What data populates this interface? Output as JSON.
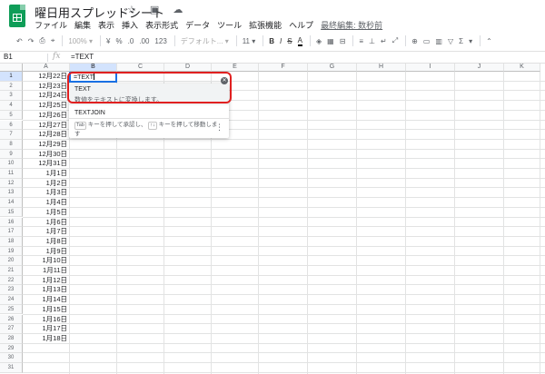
{
  "app": {
    "doc_title": "曜日用スプレッドシート",
    "title_icons": "☆ ▣ ☁"
  },
  "menu": {
    "items": [
      "ファイル",
      "編集",
      "表示",
      "挿入",
      "表示形式",
      "データ",
      "ツール",
      "拡張機能",
      "ヘルプ"
    ],
    "last_edit": "最終編集: 数秒前"
  },
  "toolbar": {
    "undo": "↶",
    "redo": "↷",
    "print": "⎙",
    "paint": "⌖",
    "zoom": "100%",
    "zoom_caret": "▾",
    "currency": "¥",
    "percent": "%",
    "dec_less": ".0",
    "dec_more": ".00",
    "more_formats": "123",
    "font": "デフォルト...",
    "font_caret": "▾",
    "font_size": "11",
    "size_caret": "▾",
    "bold": "B",
    "italic": "I",
    "strike": "S",
    "text_color": "A",
    "fill": "◈",
    "borders": "▦",
    "merge": "⊟",
    "halign": "≡",
    "valign": "⊥",
    "wrap": "↵",
    "rotate": "⤢",
    "link": "⊕",
    "comment": "▭",
    "chart": "▥",
    "filter": "▽",
    "functions": "Σ",
    "more_caret": "▾",
    "collapse": "⌃"
  },
  "formula_bar": {
    "name_box": "B1",
    "fx": "fx",
    "content": "=TEXT"
  },
  "grid": {
    "columns": [
      "A",
      "B",
      "C",
      "D",
      "E",
      "F",
      "G",
      "H",
      "I",
      "J",
      "K"
    ],
    "rows": [
      "1",
      "2",
      "3",
      "4",
      "5",
      "6",
      "7",
      "8",
      "9",
      "10",
      "11",
      "12",
      "13",
      "14",
      "15",
      "16",
      "17",
      "18",
      "19",
      "20",
      "21",
      "22",
      "23",
      "24",
      "25",
      "26",
      "27",
      "28",
      "29",
      "30",
      "31"
    ],
    "column_a_values": [
      "12月22日",
      "12月23日",
      "12月24日",
      "12月25日",
      "12月26日",
      "12月27日",
      "12月28日",
      "12月29日",
      "12月30日",
      "12月31日",
      "1月1日",
      "1月2日",
      "1月3日",
      "1月4日",
      "1月5日",
      "1月6日",
      "1月7日",
      "1月8日",
      "1月9日",
      "1月10日",
      "1月11日",
      "1月12日",
      "1月13日",
      "1月14日",
      "1月15日",
      "1月16日",
      "1月17日",
      "1月18日"
    ]
  },
  "editor": {
    "value": "=TEXT"
  },
  "autocomplete": {
    "suggestion_1_name": "TEXT",
    "suggestion_1_desc": "数値をテキストに変換します。",
    "suggestion_2_name": "TEXTJOIN",
    "hint_tab": "Tab",
    "hint_part1": "キーを押して承認し、",
    "hint_arrows": "↑↓",
    "hint_part2": "キーを押して移動します",
    "more_icon": "⋮",
    "close_icon": "✕"
  },
  "colors": {
    "accent": "#1a73e8",
    "annotation": "#e02020",
    "sheets_green": "#0f9d58"
  }
}
